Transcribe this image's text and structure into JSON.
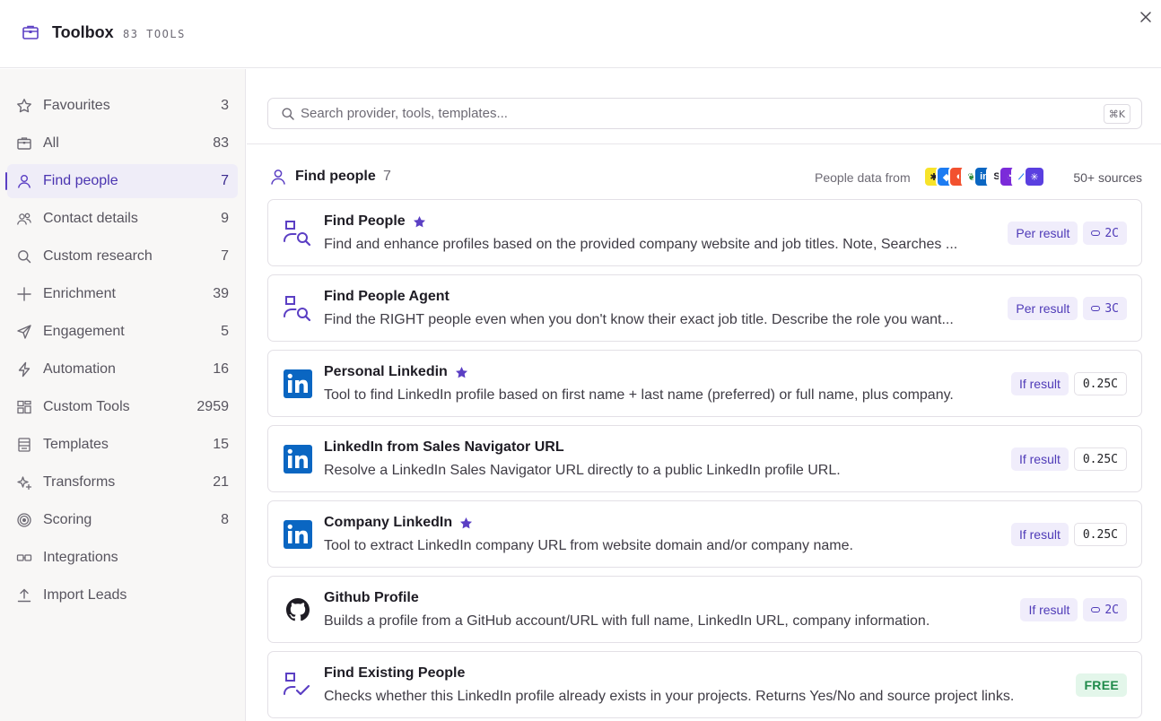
{
  "header": {
    "title": "Toolbox",
    "count": "83 TOOLS"
  },
  "search": {
    "placeholder": "Search provider, tools, templates...",
    "shortcut": "⌘K"
  },
  "sidebar": {
    "items": [
      {
        "label": "Favourites",
        "count": "3",
        "icon": "star-icon"
      },
      {
        "label": "All",
        "count": "83",
        "icon": "toolbox-icon"
      },
      {
        "label": "Find people",
        "count": "7",
        "icon": "person-icon",
        "active": true
      },
      {
        "label": "Contact details",
        "count": "9",
        "icon": "contacts-icon"
      },
      {
        "label": "Custom research",
        "count": "7",
        "icon": "search-icon"
      },
      {
        "label": "Enrichment",
        "count": "39",
        "icon": "plus-icon"
      },
      {
        "label": "Engagement",
        "count": "5",
        "icon": "send-icon"
      },
      {
        "label": "Automation",
        "count": "16",
        "icon": "lightning-icon"
      },
      {
        "label": "Custom Tools",
        "count": "2959",
        "icon": "custom-tools-icon"
      },
      {
        "label": "Templates",
        "count": "15",
        "icon": "templates-icon"
      },
      {
        "label": "Transforms",
        "count": "21",
        "icon": "sparkle-icon"
      },
      {
        "label": "Scoring",
        "count": "8",
        "icon": "target-icon"
      },
      {
        "label": "Integrations",
        "count": "",
        "icon": "integrations-icon"
      },
      {
        "label": "Import Leads",
        "count": "",
        "icon": "upload-icon"
      }
    ]
  },
  "section": {
    "title": "Find people",
    "count": "7",
    "sources_label": "People data from",
    "sources_count": "50+ sources"
  },
  "tools": [
    {
      "title": "Find People",
      "desc": "Find and enhance profiles based on the provided company website and job titles. Note, Searches ...",
      "pricing": "Per result",
      "cost": "2C",
      "icon": "find-people-icon",
      "favourite": true
    },
    {
      "title": "Find People Agent",
      "desc": "Find the RIGHT people even when you don't know their exact job title. Describe the role you want...",
      "pricing": "Per result",
      "cost": "3C",
      "icon": "find-people-icon",
      "favourite": false
    },
    {
      "title": "Personal Linkedin",
      "desc": "Tool to find LinkedIn profile based on first name + last name (preferred) or full name, plus company.",
      "pricing": "If result",
      "cost": "0.25C",
      "icon": "linkedin-icon",
      "favourite": true
    },
    {
      "title": "LinkedIn from Sales Navigator URL",
      "desc": "Resolve a LinkedIn Sales Navigator URL directly to a public LinkedIn profile URL.",
      "pricing": "If result",
      "cost": "0.25C",
      "icon": "linkedin-icon",
      "favourite": false
    },
    {
      "title": "Company LinkedIn",
      "desc": "Tool to extract LinkedIn company URL from website domain and/or company name.",
      "pricing": "If result",
      "cost": "0.25C",
      "icon": "linkedin-icon",
      "favourite": true
    },
    {
      "title": "Github Profile",
      "desc": "Builds a profile from a GitHub account/URL with full name, LinkedIn URL, company information.",
      "pricing": "If result",
      "cost": "2C",
      "icon": "github-icon",
      "favourite": false
    },
    {
      "title": "Find Existing People",
      "desc": "Checks whether this LinkedIn profile already exists in your projects. Returns Yes/No and source project links.",
      "pricing": "",
      "cost": "FREE",
      "icon": "person-check-icon",
      "favourite": false
    }
  ],
  "colors": {
    "accent": "#5b3fc4",
    "linkedin": "#0a66c2",
    "free_bg": "#e3f6ea",
    "free_text": "#1f8a4a"
  }
}
